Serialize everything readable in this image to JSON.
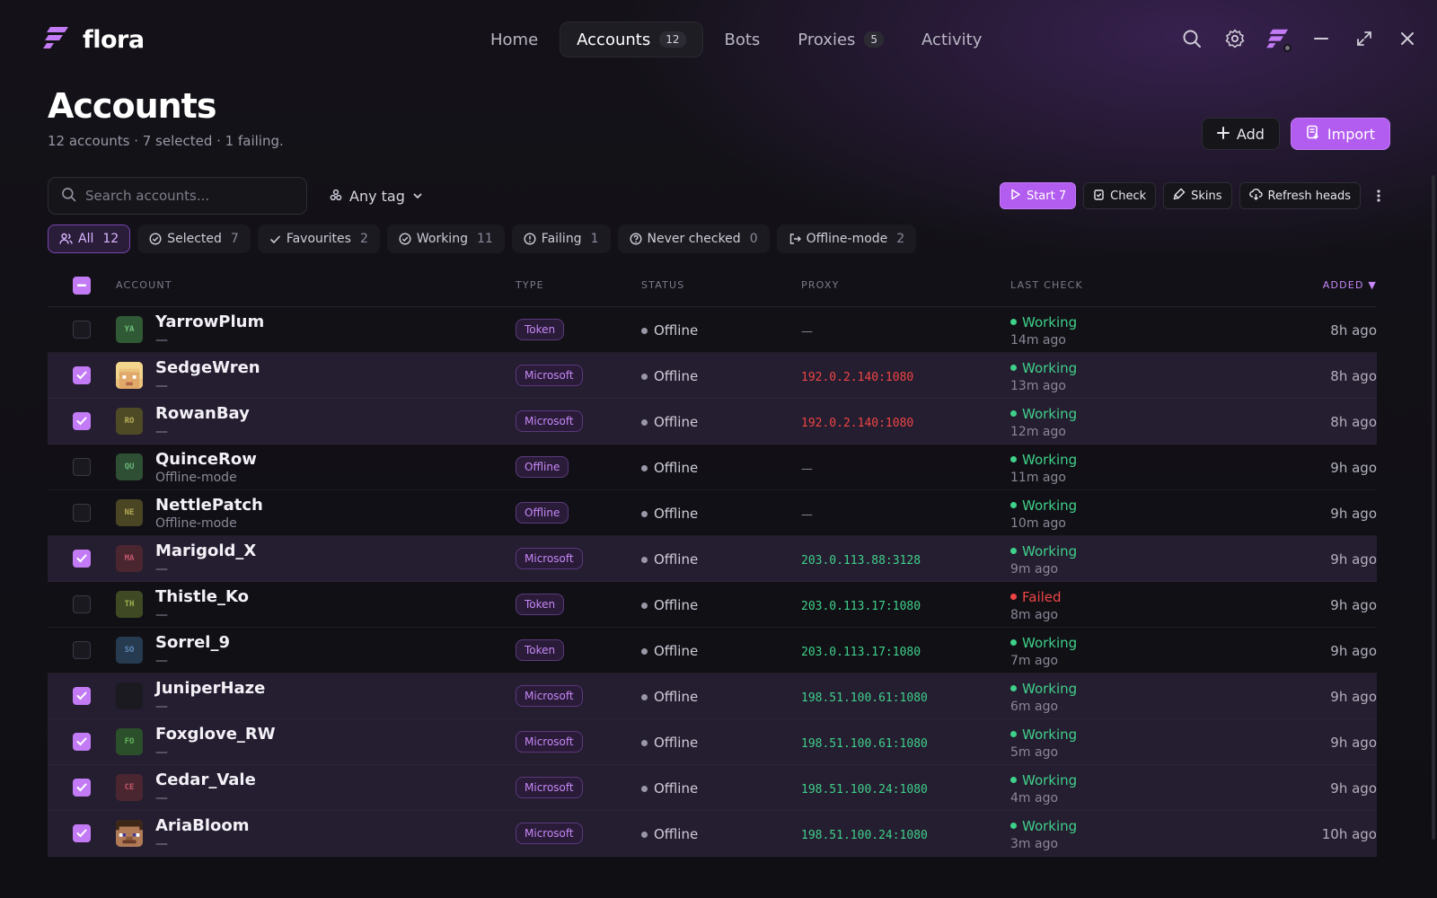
{
  "app": {
    "name": "flora"
  },
  "nav": {
    "tabs": [
      {
        "label": "Home",
        "badge": ""
      },
      {
        "label": "Accounts",
        "badge": "12",
        "active": true
      },
      {
        "label": "Bots",
        "badge": ""
      },
      {
        "label": "Proxies",
        "badge": "5"
      },
      {
        "label": "Activity",
        "badge": ""
      }
    ]
  },
  "page": {
    "title": "Accounts",
    "subtitle": "12 accounts · 7 selected · 1 failing.",
    "add_label": "Add",
    "import_label": "Import"
  },
  "toolbar": {
    "search_placeholder": "Search accounts...",
    "tag_label": "Any tag",
    "start_label": "Start 7",
    "check_label": "Check",
    "skins_label": "Skins",
    "refresh_label": "Refresh heads"
  },
  "filters": [
    {
      "label": "All",
      "count": "12",
      "icon": "users-icon",
      "active": true
    },
    {
      "label": "Selected",
      "count": "7",
      "icon": "check-circle-icon"
    },
    {
      "label": "Favourites",
      "count": "2",
      "icon": "check-icon"
    },
    {
      "label": "Working",
      "count": "11",
      "icon": "check-circle-icon"
    },
    {
      "label": "Failing",
      "count": "1",
      "icon": "alert-circle-icon"
    },
    {
      "label": "Never checked",
      "count": "0",
      "icon": "question-circle-icon"
    },
    {
      "label": "Offline-mode",
      "count": "2",
      "icon": "logout-icon"
    }
  ],
  "table": {
    "headers": {
      "account": "ACCOUNT",
      "type": "TYPE",
      "status": "STATUS",
      "proxy": "PROXY",
      "last_check": "LAST CHECK",
      "added": "ADDED"
    },
    "rows": [
      {
        "name": "YarrowPlum",
        "sub": "—",
        "initials": "YA",
        "avatar_bg": "#2f5a35",
        "avatar_fg": "#6fbd7c",
        "type": "Token",
        "status": "Offline",
        "proxy": "—",
        "proxy_kind": "none",
        "last_state": "Working",
        "last_ago": "14m ago",
        "added": "8h ago",
        "selected": false
      },
      {
        "name": "SedgeWren",
        "sub": "—",
        "initials": "",
        "avatar_bg": "#e8c07a",
        "avatar_fg": "#8a5a2a",
        "avatar_style": "blonde-head",
        "type": "Microsoft",
        "status": "Offline",
        "proxy": "192.0.2.140:1080",
        "proxy_kind": "bad",
        "last_state": "Working",
        "last_ago": "13m ago",
        "added": "8h ago",
        "selected": true
      },
      {
        "name": "RowanBay",
        "sub": "—",
        "initials": "RO",
        "avatar_bg": "#4e4a25",
        "avatar_fg": "#b7ad5a",
        "type": "Microsoft",
        "status": "Offline",
        "proxy": "192.0.2.140:1080",
        "proxy_kind": "bad",
        "last_state": "Working",
        "last_ago": "12m ago",
        "added": "8h ago",
        "selected": true
      },
      {
        "name": "QuinceRow",
        "sub": "Offline-mode",
        "initials": "QU",
        "avatar_bg": "#2e4f33",
        "avatar_fg": "#69b377",
        "type": "Offline",
        "status": "Offline",
        "proxy": "—",
        "proxy_kind": "none",
        "last_state": "Working",
        "last_ago": "11m ago",
        "added": "9h ago",
        "selected": false
      },
      {
        "name": "NettlePatch",
        "sub": "Offline-mode",
        "initials": "NE",
        "avatar_bg": "#4a4624",
        "avatar_fg": "#b2a857",
        "type": "Offline",
        "status": "Offline",
        "proxy": "—",
        "proxy_kind": "none",
        "last_state": "Working",
        "last_ago": "10m ago",
        "added": "9h ago",
        "selected": false
      },
      {
        "name": "Marigold_X",
        "sub": "—",
        "initials": "MA",
        "avatar_bg": "#4a2630",
        "avatar_fg": "#c2566b",
        "type": "Microsoft",
        "status": "Offline",
        "proxy": "203.0.113.88:3128",
        "proxy_kind": "ok",
        "last_state": "Working",
        "last_ago": "9m ago",
        "added": "9h ago",
        "selected": true
      },
      {
        "name": "Thistle_Ko",
        "sub": "—",
        "initials": "TH",
        "avatar_bg": "#3f4a24",
        "avatar_fg": "#9fb052",
        "type": "Token",
        "status": "Offline",
        "proxy": "203.0.113.17:1080",
        "proxy_kind": "ok",
        "last_state": "Failed",
        "last_ago": "8m ago",
        "added": "9h ago",
        "selected": false
      },
      {
        "name": "Sorrel_9",
        "sub": "—",
        "initials": "SO",
        "avatar_bg": "#263a50",
        "avatar_fg": "#5f89b8",
        "type": "Token",
        "status": "Offline",
        "proxy": "203.0.113.17:1080",
        "proxy_kind": "ok",
        "last_state": "Working",
        "last_ago": "7m ago",
        "added": "9h ago",
        "selected": false
      },
      {
        "name": "JuniperHaze",
        "sub": "—",
        "initials": "",
        "avatar_bg": "#1b1a20",
        "avatar_fg": "#1b1a20",
        "type": "Microsoft",
        "status": "Offline",
        "proxy": "198.51.100.61:1080",
        "proxy_kind": "ok",
        "last_state": "Working",
        "last_ago": "6m ago",
        "added": "9h ago",
        "selected": true
      },
      {
        "name": "Foxglove_RW",
        "sub": "—",
        "initials": "FO",
        "avatar_bg": "#2b4f2a",
        "avatar_fg": "#64b35e",
        "type": "Microsoft",
        "status": "Offline",
        "proxy": "198.51.100.61:1080",
        "proxy_kind": "ok",
        "last_state": "Working",
        "last_ago": "5m ago",
        "added": "9h ago",
        "selected": true
      },
      {
        "name": "Cedar_Vale",
        "sub": "—",
        "initials": "CE",
        "avatar_bg": "#4a2630",
        "avatar_fg": "#c2566b",
        "type": "Microsoft",
        "status": "Offline",
        "proxy": "198.51.100.24:1080",
        "proxy_kind": "ok",
        "last_state": "Working",
        "last_ago": "4m ago",
        "added": "9h ago",
        "selected": true
      },
      {
        "name": "AriaBloom",
        "sub": "—",
        "initials": "",
        "avatar_bg": "#4a2f1c",
        "avatar_fg": "#8a5a2a",
        "avatar_style": "steve-head",
        "type": "Microsoft",
        "status": "Offline",
        "proxy": "198.51.100.24:1080",
        "proxy_kind": "ok",
        "last_state": "Working",
        "last_ago": "3m ago",
        "added": "10h ago",
        "selected": true
      }
    ]
  },
  "colors": {
    "accent": "#b35cf0",
    "working": "#3fd08a",
    "failed": "#ef4545",
    "offline_dot": "#9a97a6"
  }
}
